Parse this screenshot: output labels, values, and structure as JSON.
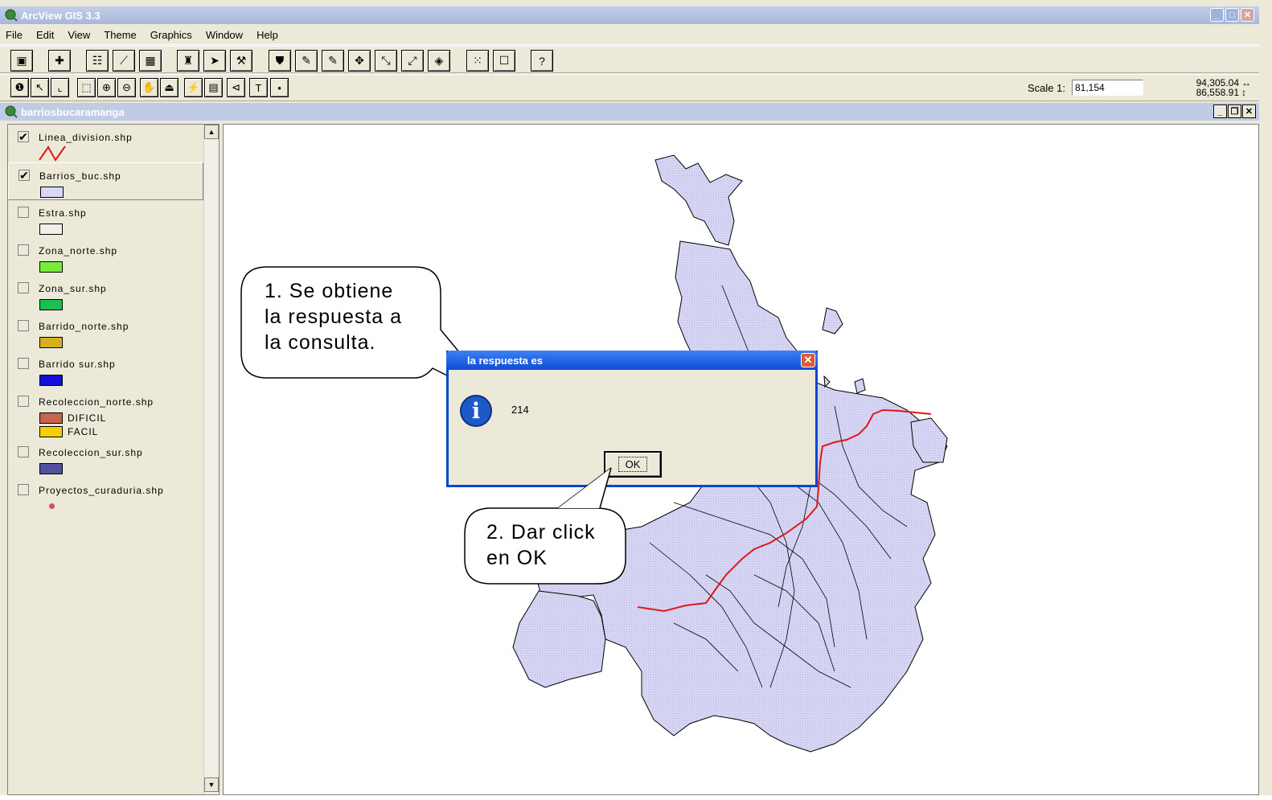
{
  "app": {
    "title": "ArcView GIS 3.3"
  },
  "menubar": [
    "File",
    "Edit",
    "View",
    "Theme",
    "Graphics",
    "Window",
    "Help"
  ],
  "toolbar2": {
    "scale_label": "Scale 1:",
    "scale_value": "81,154",
    "coord_x": "94,305.04",
    "coord_y": "86,558.91"
  },
  "view": {
    "title": "barriosbucaramanga"
  },
  "toc": {
    "layers": [
      {
        "name": "Linea_division.shp",
        "checked": true,
        "symbol": "red-line"
      },
      {
        "name": "Barrios_buc.shp",
        "checked": true,
        "fill": "#d8d8f6"
      },
      {
        "name": "Estra.shp",
        "checked": false,
        "fill": "#f2f0e6"
      },
      {
        "name": "Zona_norte.shp",
        "checked": false,
        "fill": "#78ec3c"
      },
      {
        "name": "Zona_sur.shp",
        "checked": false,
        "fill": "#1cc050"
      },
      {
        "name": "Barrido_norte.shp",
        "checked": false,
        "fill": "#d6b01e"
      },
      {
        "name": "Barrido sur.shp",
        "checked": false,
        "fill": "#1010d8"
      },
      {
        "name": "Recoleccion_norte.shp",
        "checked": false,
        "classes": [
          {
            "label": "DIFICIL",
            "fill": "#c8644c"
          },
          {
            "label": "FACIL",
            "fill": "#f4d000"
          }
        ]
      },
      {
        "name": "Recoleccion_sur.shp",
        "checked": false,
        "fill": "#5050a0"
      },
      {
        "name": "Proyectos_curaduria.shp",
        "checked": false,
        "symbol": "point",
        "fill": "#d0506c"
      }
    ]
  },
  "callouts": {
    "first": "1. Se obtiene la respuesta a la consulta.",
    "first_lines": [
      "1. Se obtiene",
      "la respuesta a",
      "la consulta."
    ],
    "second_lines": [
      "2. Dar click",
      "en OK"
    ]
  },
  "dialog": {
    "title": "la respuesta es",
    "message": "214",
    "ok_label": "OK"
  },
  "colors": {
    "title_bar": "#a8b9dc",
    "dialog_title": "#0a4ed6",
    "map_fill": "#d6d6f4",
    "division_line": "#e01818"
  }
}
